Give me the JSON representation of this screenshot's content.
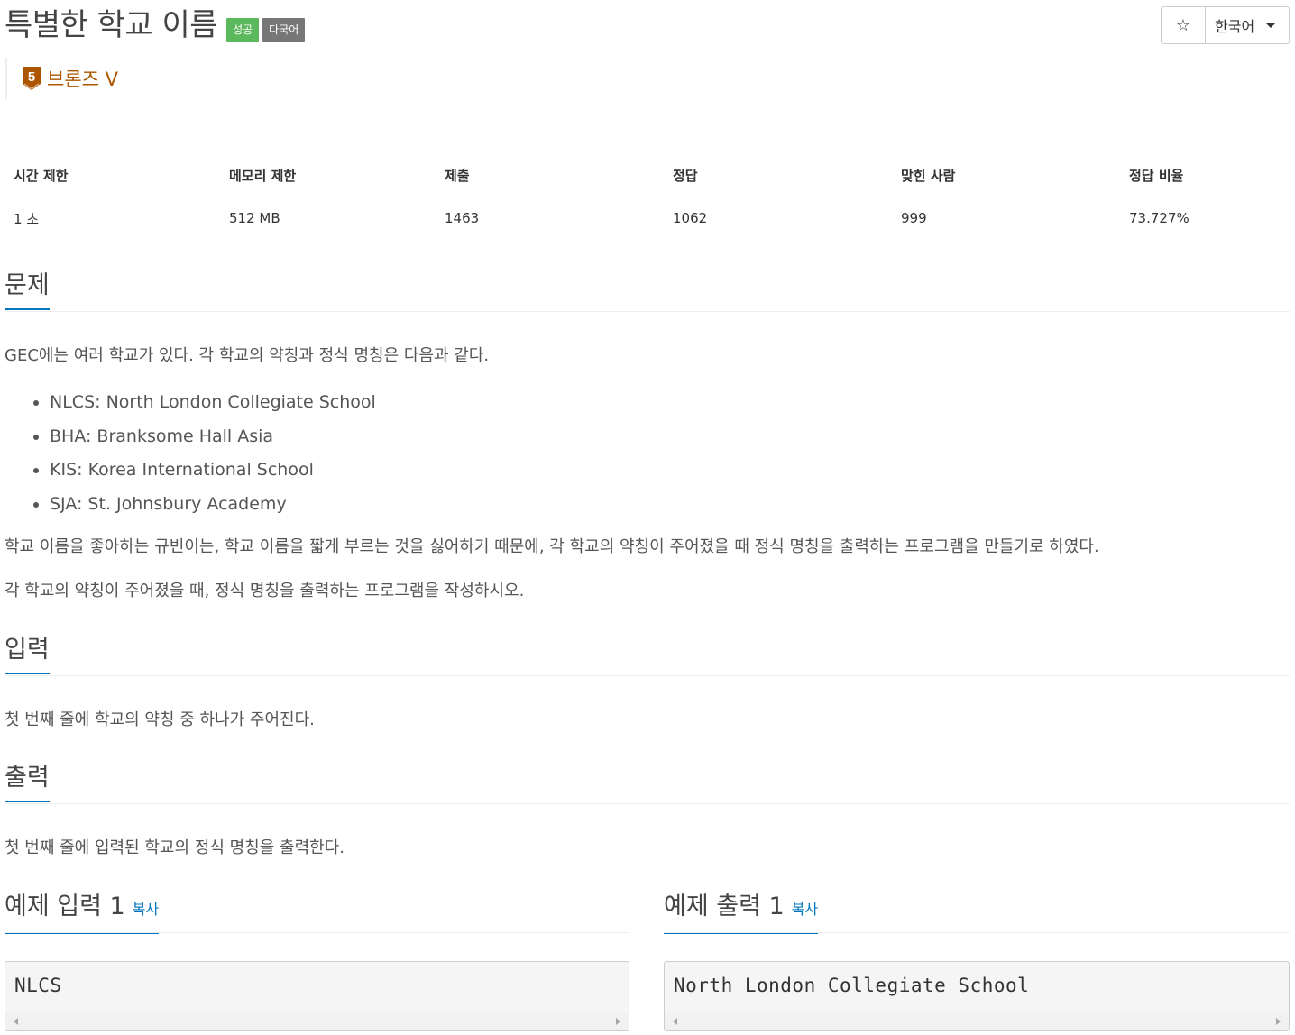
{
  "header": {
    "title": "특별한 학교 이름",
    "badge_success": "성공",
    "badge_multilang": "다국어",
    "star_icon": "☆",
    "language": "한국어"
  },
  "tier": {
    "number": "5",
    "label": "브론즈 V",
    "color": "#ad5600"
  },
  "stats": {
    "headers": [
      "시간 제한",
      "메모리 제한",
      "제출",
      "정답",
      "맞힌 사람",
      "정답 비율"
    ],
    "values": [
      "1 초",
      "512 MB",
      "1463",
      "1062",
      "999",
      "73.727%"
    ]
  },
  "problem": {
    "heading": "문제",
    "intro": "GEC에는 여러 학교가 있다. 각 학교의 약칭과 정식 명칭은 다음과 같다.",
    "schools": [
      "NLCS: North London Collegiate School",
      "BHA: Branksome Hall Asia",
      "KIS: Korea International School",
      "SJA: St. Johnsbury Academy"
    ],
    "para2": "학교 이름을 좋아하는 규빈이는, 학교 이름을 짧게 부르는 것을 싫어하기 때문에, 각 학교의 약칭이 주어졌을 때 정식 명칭을 출력하는 프로그램을 만들기로 하였다.",
    "para3": "각 학교의 약칭이 주어졌을 때, 정식 명칭을 출력하는 프로그램을 작성하시오."
  },
  "input": {
    "heading": "입력",
    "text": "첫 번째 줄에 학교의 약칭 중 하나가 주어진다."
  },
  "output": {
    "heading": "출력",
    "text": "첫 번째 줄에 입력된 학교의 정식 명칭을 출력한다."
  },
  "samples": {
    "input_heading": "예제 입력 1",
    "output_heading": "예제 출력 1",
    "copy_label": "복사",
    "input_value": "NLCS",
    "output_value": "North London Collegiate School"
  },
  "colors": {
    "accent": "#0076c0",
    "success": "#5cb85c",
    "default_badge": "#777777"
  }
}
